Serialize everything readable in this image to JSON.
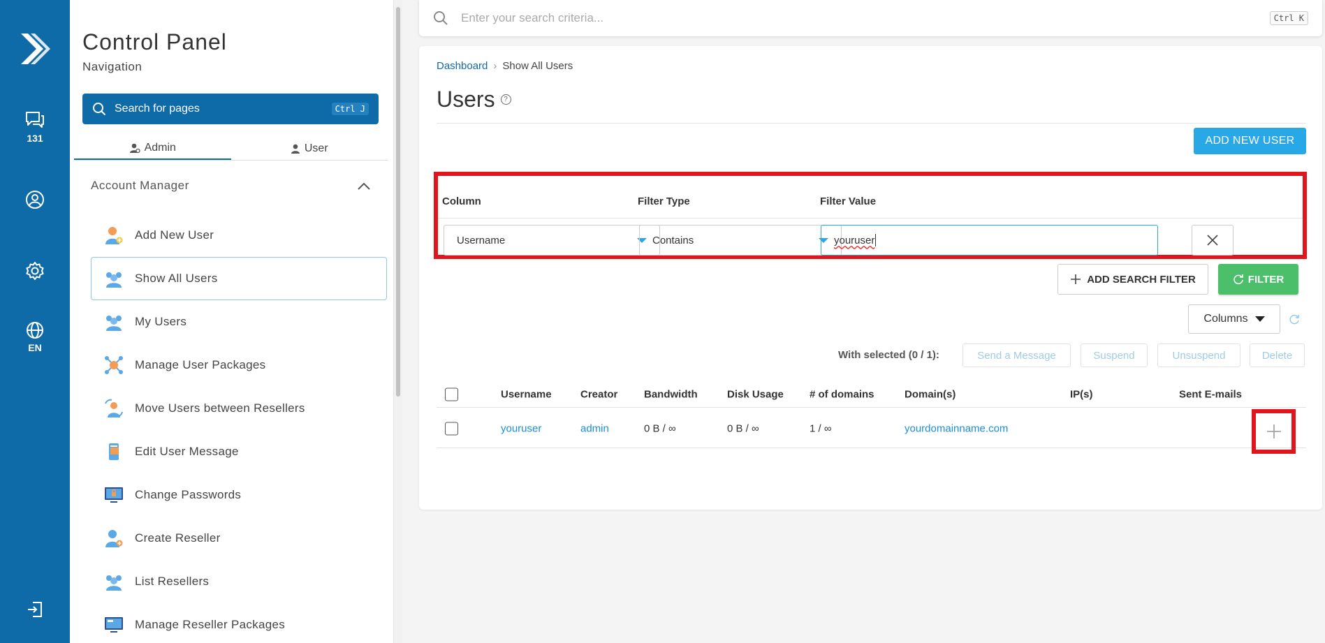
{
  "rail": {
    "messages_count": "131",
    "language": "EN"
  },
  "sidebar": {
    "title": "Control Panel",
    "subtitle": "Navigation",
    "search_label": "Search for pages",
    "search_shortcut": "Ctrl J",
    "tabs": [
      {
        "label": "Admin",
        "active": true
      },
      {
        "label": "User",
        "active": false
      }
    ],
    "section_title": "Account Manager",
    "items": [
      {
        "label": "Add New User",
        "icon": "user-add-icon"
      },
      {
        "label": "Show All Users",
        "icon": "users-icon",
        "active": true
      },
      {
        "label": "My Users",
        "icon": "users-icon"
      },
      {
        "label": "Manage User Packages",
        "icon": "package-network-icon"
      },
      {
        "label": "Move Users between Resellers",
        "icon": "user-move-icon"
      },
      {
        "label": "Edit User Message",
        "icon": "message-icon"
      },
      {
        "label": "Change Passwords",
        "icon": "monitor-lock-icon"
      },
      {
        "label": "Create Reseller",
        "icon": "user-add-icon"
      },
      {
        "label": "List Resellers",
        "icon": "users-icon"
      },
      {
        "label": "Manage Reseller Packages",
        "icon": "monitor-icon"
      }
    ]
  },
  "topbar": {
    "search_placeholder": "Enter your search criteria...",
    "shortcut": "Ctrl K"
  },
  "breadcrumb": {
    "home": "Dashboard",
    "separator": "›",
    "current": "Show All Users"
  },
  "page": {
    "title": "Users",
    "help": "?",
    "add_button": "ADD NEW USER"
  },
  "filter": {
    "col_header": "Column",
    "type_header": "Filter Type",
    "value_header": "Filter Value",
    "column_value": "Username",
    "type_value": "Contains",
    "filter_value": "youruser",
    "add_filter_label": "ADD SEARCH FILTER",
    "filter_button": "FILTER",
    "columns_button": "Columns"
  },
  "selection": {
    "label": "With selected (0 / 1):",
    "actions": [
      "Send a Message",
      "Suspend",
      "Unsuspend",
      "Delete"
    ]
  },
  "table": {
    "headers": [
      "Username",
      "Creator",
      "Bandwidth",
      "Disk Usage",
      "# of domains",
      "Domain(s)",
      "IP(s)",
      "Sent E-mails"
    ],
    "rows": [
      {
        "username": "youruser",
        "creator": "admin",
        "bandwidth": "0 B / ∞",
        "disk": "0 B / ∞",
        "domains": "1 / ∞",
        "domain": "yourdomainname.com",
        "ips": "",
        "sent": ""
      }
    ]
  },
  "colors": {
    "brand": "#0f6aa8",
    "accent": "#29a8e8",
    "success": "#4cbf6a",
    "highlight": "#e0161f"
  }
}
